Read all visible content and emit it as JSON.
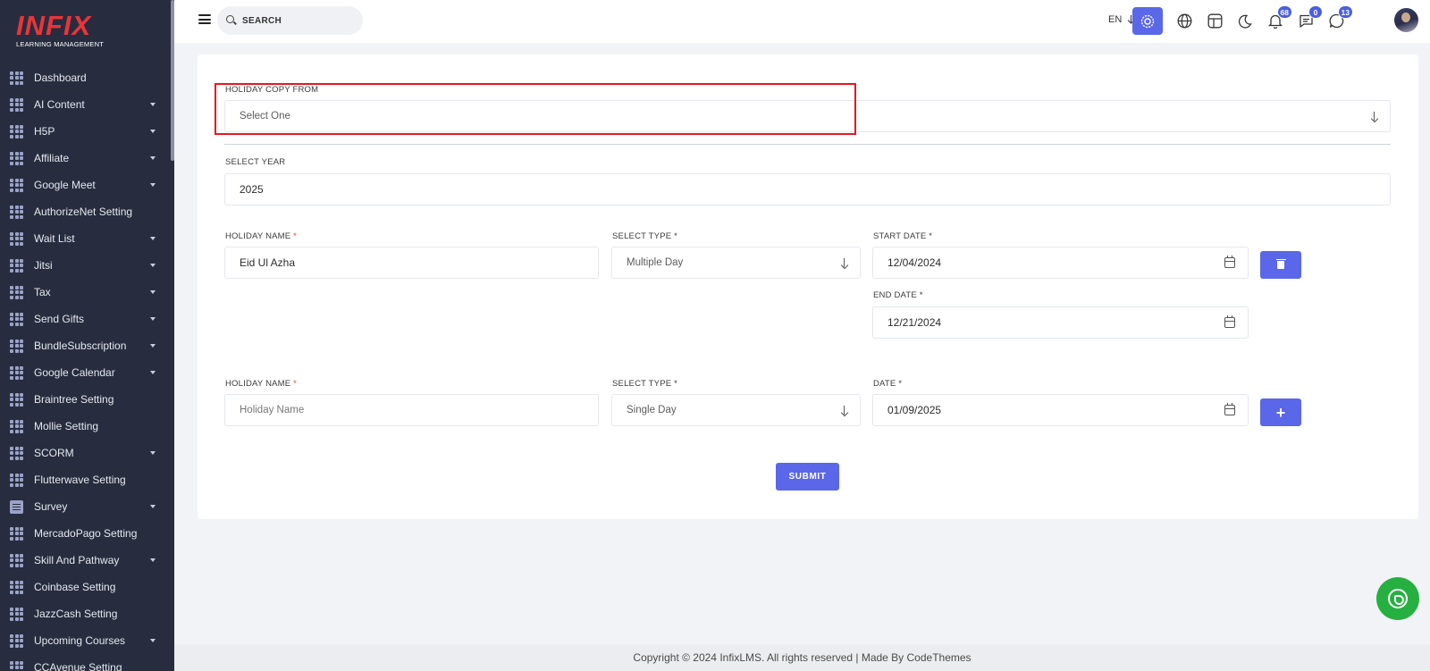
{
  "brand": {
    "logo_text": "INFIX",
    "logo_subtitle": "LEARNING MANAGEMENT"
  },
  "sidebar": {
    "items": [
      {
        "label": "Dashboard",
        "icon": "grid-icon",
        "has_submenu": false
      },
      {
        "label": "AI Content",
        "icon": "grid-icon",
        "has_submenu": true
      },
      {
        "label": "H5P",
        "icon": "grid-icon",
        "has_submenu": true
      },
      {
        "label": "Affiliate",
        "icon": "grid-icon",
        "has_submenu": true
      },
      {
        "label": "Google Meet",
        "icon": "grid-icon",
        "has_submenu": true
      },
      {
        "label": "AuthorizeNet Setting",
        "icon": "grid-icon",
        "has_submenu": false
      },
      {
        "label": "Wait List",
        "icon": "grid-icon",
        "has_submenu": true
      },
      {
        "label": "Jitsi",
        "icon": "grid-icon",
        "has_submenu": true
      },
      {
        "label": "Tax",
        "icon": "grid-icon",
        "has_submenu": true
      },
      {
        "label": "Send Gifts",
        "icon": "grid-icon",
        "has_submenu": true
      },
      {
        "label": "BundleSubscription",
        "icon": "grid-icon",
        "has_submenu": true
      },
      {
        "label": "Google Calendar",
        "icon": "grid-icon",
        "has_submenu": true
      },
      {
        "label": "Braintree Setting",
        "icon": "grid-icon",
        "has_submenu": false
      },
      {
        "label": "Mollie Setting",
        "icon": "grid-icon",
        "has_submenu": false
      },
      {
        "label": "SCORM",
        "icon": "grid-icon",
        "has_submenu": true
      },
      {
        "label": "Flutterwave Setting",
        "icon": "grid-icon",
        "has_submenu": false
      },
      {
        "label": "Survey",
        "icon": "document-icon",
        "has_submenu": true
      },
      {
        "label": "MercadoPago Setting",
        "icon": "grid-icon",
        "has_submenu": false
      },
      {
        "label": "Skill And Pathway",
        "icon": "grid-icon",
        "has_submenu": true
      },
      {
        "label": "Coinbase Setting",
        "icon": "grid-icon",
        "has_submenu": false
      },
      {
        "label": "JazzCash Setting",
        "icon": "grid-icon",
        "has_submenu": false
      },
      {
        "label": "Upcoming Courses",
        "icon": "grid-icon",
        "has_submenu": true
      },
      {
        "label": "CCAvenue Setting",
        "icon": "grid-icon",
        "has_submenu": false
      }
    ]
  },
  "header": {
    "search_placeholder": "SEARCH",
    "language": "EN",
    "notifications_count": "68",
    "messages_count": "0",
    "chat_count": "13"
  },
  "form": {
    "copy_from_label": "HOLIDAY COPY FROM",
    "copy_from_value": "Select One",
    "year_label": "SELECT YEAR",
    "year_value": "2025",
    "row1": {
      "name_label": "HOLIDAY NAME",
      "name_value": "Eid Ul Azha",
      "type_label": "SELECT TYPE *",
      "type_value": "Multiple Day",
      "start_label": "START DATE *",
      "start_value": "12/04/2024",
      "end_label": "END DATE *",
      "end_value": "12/21/2024"
    },
    "row2": {
      "name_label": "HOLIDAY NAME",
      "name_placeholder": "Holiday Name",
      "type_label": "SELECT TYPE *",
      "type_value": "Single Day",
      "date_label": "DATE *",
      "date_value": "01/09/2025"
    },
    "required_mark": "*",
    "add_symbol": "+",
    "submit_label": "SUBMIT"
  },
  "footer": {
    "text": "Copyright © 2024 InfixLMS. All rights reserved | Made By CodeThemes"
  },
  "colors": {
    "sidebar_bg": "#272d3f",
    "accent": "#5a67e8",
    "highlight": "#e8161e",
    "whatsapp": "#25b040",
    "logo": "#e8353b"
  }
}
